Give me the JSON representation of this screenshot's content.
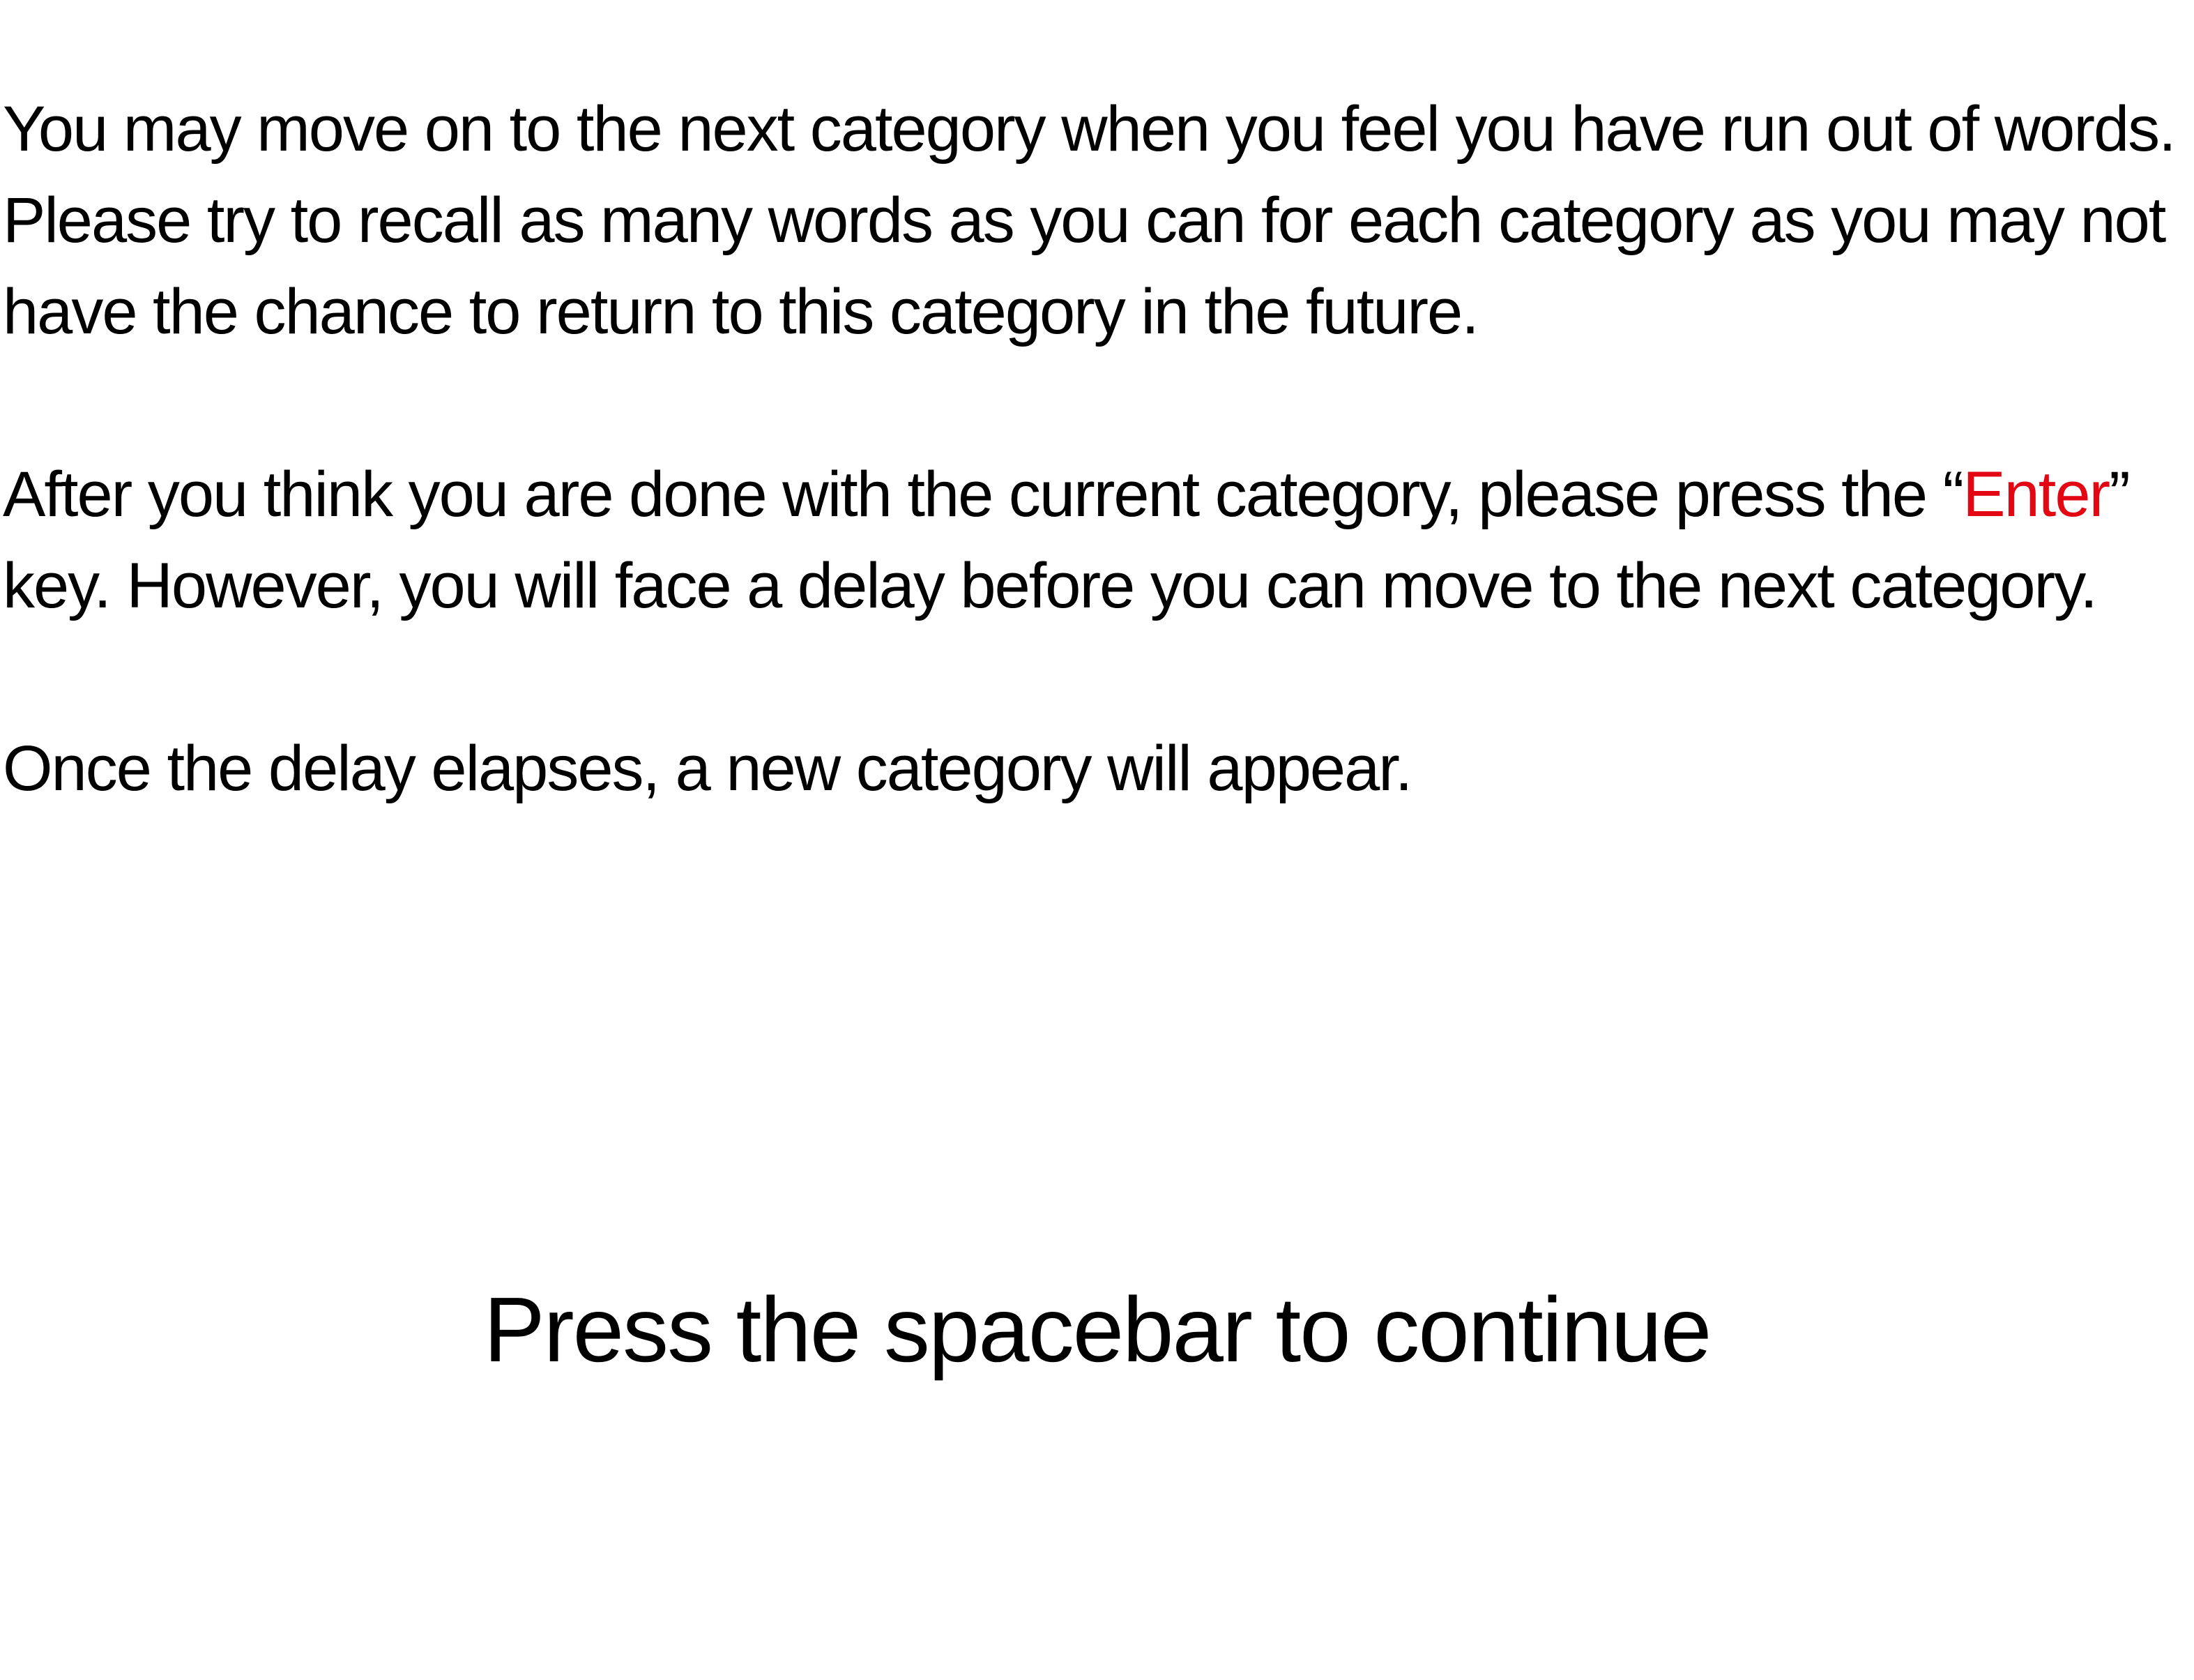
{
  "instructions": {
    "paragraph1": "You may move on to the next category when you feel you have run out of words. Please try to recall as many words as you can for each category as you may not have the chance to return to this category in the future.",
    "paragraph2": {
      "before": "After you think you are done with the current category, please press the “",
      "key": "Enter",
      "after": "” key. However, you will face a delay before you can move to the next category."
    },
    "paragraph3": "Once the delay elapses, a new category will appear."
  },
  "prompt": {
    "text": "Press the spacebar to continue"
  },
  "colors": {
    "background": "#ffffff",
    "text": "#000000",
    "highlight": "#e30613"
  }
}
